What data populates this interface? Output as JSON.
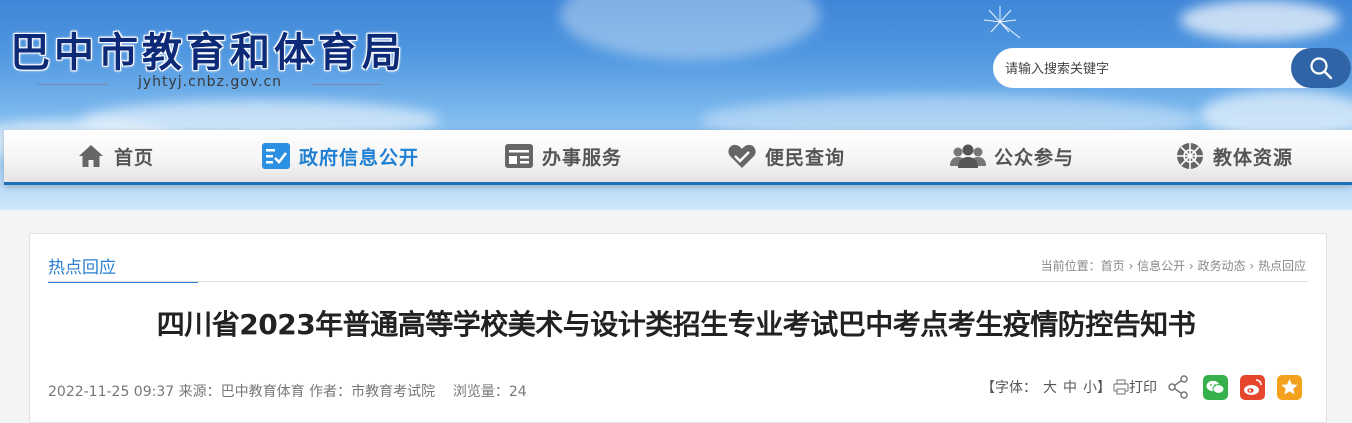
{
  "header": {
    "site_title": "巴中市教育和体育局",
    "site_domain": "jyhtyj.cnbz.gov.cn"
  },
  "search": {
    "placeholder": "请输入搜索关键字"
  },
  "nav": {
    "items": [
      {
        "label": "首页",
        "icon": "home-icon"
      },
      {
        "label": "政府信息公开",
        "icon": "checklist-icon",
        "active": true
      },
      {
        "label": "办事服务",
        "icon": "id-card-icon"
      },
      {
        "label": "便民查询",
        "icon": "heart-hands-icon"
      },
      {
        "label": "公众参与",
        "icon": "people-icon"
      },
      {
        "label": "教体资源",
        "icon": "ball-icon"
      }
    ],
    "active_color": "#1f7fd2"
  },
  "section": {
    "tab_label": "热点回应"
  },
  "breadcrumb": {
    "prefix": "当前位置：",
    "items": [
      "首页",
      "信息公开",
      "政务动态",
      "热点回应"
    ],
    "separator": " › "
  },
  "article": {
    "title": "四川省2023年普通高等学校美术与设计类招生专业考试巴中考点考生疫情防控告知书",
    "date": "2022-11-25 09:37",
    "source_label": "来源：",
    "source": "巴中教育体育",
    "author_label": "作者：",
    "author": "市教育考试院",
    "views_label": "浏览量：",
    "views": "24"
  },
  "tools": {
    "font_label": "【字体：",
    "font_large": "大",
    "font_medium": "中",
    "font_small": "小",
    "font_close": "】",
    "print_label": "打印",
    "share_icons": [
      "share-icon",
      "wechat-icon",
      "weibo-icon",
      "favorite-icon"
    ]
  },
  "colors": {
    "accent": "#2b7fd0",
    "nav_border": "#1f6fb8",
    "search_button": "#2f65a6",
    "wechat": "#35b04a",
    "weibo": "#e5462c",
    "favorite": "#f4a21d"
  }
}
